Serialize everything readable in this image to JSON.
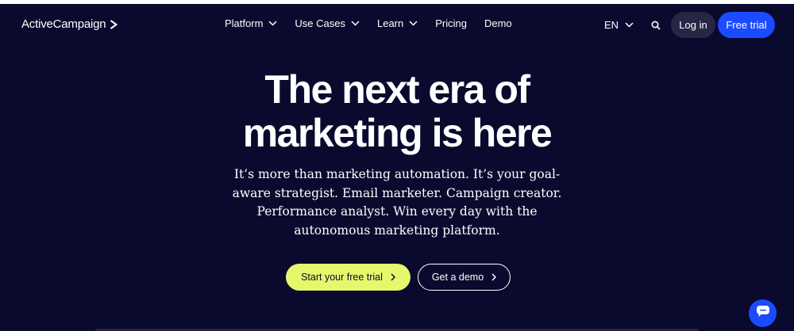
{
  "colors": {
    "background": "#0a0a2e",
    "primary_cta": "#e6f76b",
    "brand_blue": "#1c4bff",
    "login_bg": "#262645"
  },
  "header": {
    "logo": "ActiveCampaign",
    "menu": [
      {
        "label": "Platform",
        "has_dropdown": true
      },
      {
        "label": "Use Cases",
        "has_dropdown": true
      },
      {
        "label": "Learn",
        "has_dropdown": true
      },
      {
        "label": "Pricing",
        "has_dropdown": false
      },
      {
        "label": "Demo",
        "has_dropdown": false
      }
    ],
    "language": "EN",
    "search_icon": "search-icon",
    "login": "Log in",
    "free_trial": "Free trial"
  },
  "hero": {
    "title_line1": "The next era of",
    "title_line2": "marketing is here",
    "subtitle": "It’s more than marketing automation. It’s your goal-aware strategist. Email marketer. Campaign creator. Performance analyst. Win every day with the autonomous marketing platform.",
    "cta_primary": "Start your free trial",
    "cta_secondary": "Get a demo"
  },
  "chat_widget_icon": "chat-icon"
}
